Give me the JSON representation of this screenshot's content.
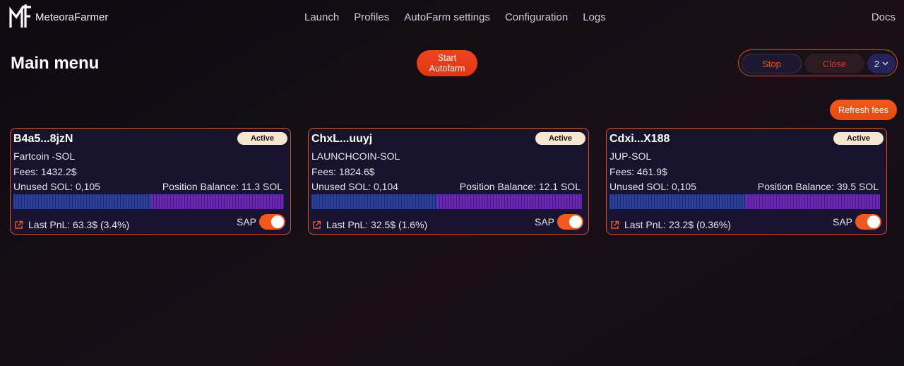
{
  "header": {
    "brand": "MeteoraFarmer",
    "nav": [
      "Launch",
      "Profiles",
      "AutoFarm settings",
      "Configuration",
      "Logs"
    ],
    "docs": "Docs"
  },
  "main": {
    "title": "Main menu",
    "start_line1": "Start",
    "start_line2": "Autofarm",
    "stop": "Stop",
    "close": "Close",
    "count": "2",
    "refresh": "Refresh fees"
  },
  "colors": {
    "accent": "#f15a1e",
    "card_border": "#d9501f",
    "bar_primary": "#2b3f9c",
    "bar_secondary": "#6a26b4",
    "badge_bg": "#f7e6cf"
  },
  "cards": [
    {
      "id": "B4a5...8jzN",
      "status": "Active",
      "pair": "Fartcoin -SOL",
      "fees": "Fees: 1432.2$",
      "unused": "Unused SOL: 0,105",
      "balance": "Position Balance: 11.3 SOL",
      "bar_fraction": 0.51,
      "pnl": "Last PnL: 63.3$ (3.4%)",
      "sap_label": "SAP",
      "sap_on": true
    },
    {
      "id": "ChxL...uuyj",
      "status": "Active",
      "pair": "LAUNCHCOIN-SOL",
      "fees": "Fees: 1824.6$",
      "unused": "Unused SOL: 0,104",
      "balance": "Position Balance: 12.1 SOL",
      "bar_fraction": 0.465,
      "pnl": "Last PnL: 32.5$ (1.6%)",
      "sap_label": "SAP",
      "sap_on": true
    },
    {
      "id": "Cdxi...X188",
      "status": "Active",
      "pair": "JUP-SOL",
      "fees": "Fees: 461.9$",
      "unused": "Unused SOL: 0,105",
      "balance": "Position Balance: 39.5 SOL",
      "bar_fraction": 0.505,
      "pnl": "Last PnL: 23.2$ (0.36%)",
      "sap_label": "SAP",
      "sap_on": true
    }
  ]
}
